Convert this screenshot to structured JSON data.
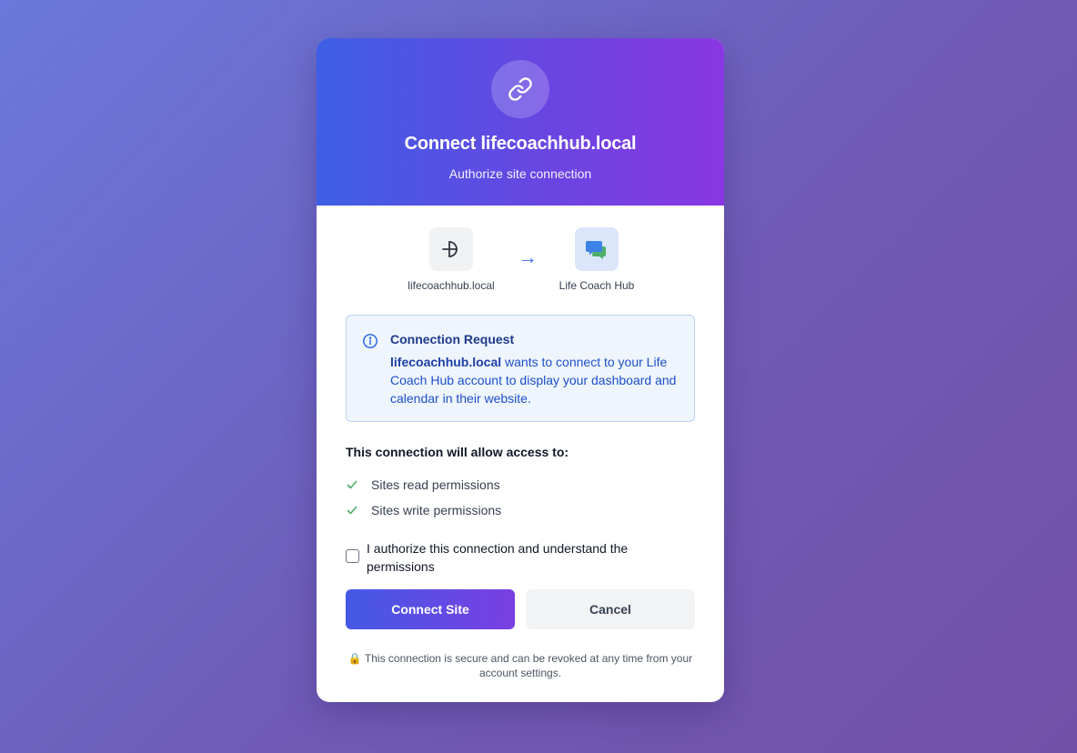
{
  "header": {
    "icon": "link-icon",
    "title": "Connect lifecoachhub.local",
    "subtitle": "Authorize site connection"
  },
  "flow": {
    "source": {
      "icon": "wordpress-plugin-icon",
      "label": "lifecoachhub.local"
    },
    "arrow": "→",
    "target": {
      "icon": "chat-bubbles-icon",
      "label": "Life Coach Hub"
    }
  },
  "info": {
    "icon": "info-icon",
    "title": "Connection Request",
    "site": "lifecoachhub.local",
    "message": " wants to connect to your Life Coach Hub account to display your dashboard and calendar in their website."
  },
  "permissions": {
    "title": "This connection will allow access to:",
    "items": [
      "Sites read permissions",
      "Sites write permissions"
    ]
  },
  "authorize": {
    "checked": false,
    "label": "I authorize this connection and understand the permissions"
  },
  "buttons": {
    "connect": "Connect Site",
    "cancel": "Cancel"
  },
  "footer": {
    "lock": "🔒",
    "note": " This connection is secure and can be revoked at any time from your account settings."
  },
  "colors": {
    "accent": "#3b6de6",
    "header_gradient_start": "#3d5fe6",
    "header_gradient_end": "#8a37e3",
    "success": "#4caf6a",
    "info_background": "#eef5fd"
  }
}
